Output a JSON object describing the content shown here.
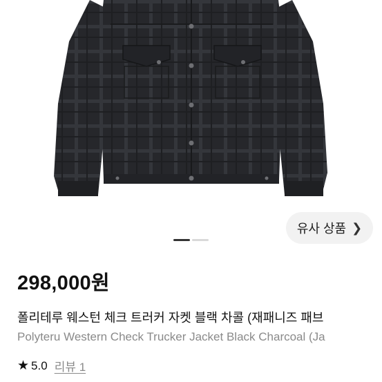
{
  "product": {
    "similar_button_label": "유사 상품",
    "price": "298,000원",
    "title_ko": "폴리테루 웨스턴 체크 트러커 자켓 블랙 차콜 (재패니즈 패브",
    "title_en": "Polyteru Western Check Trucker Jacket Black Charcoal (Ja",
    "rating_score": "5.0",
    "review_link": "리뷰 1"
  },
  "gallery": {
    "pages": 2,
    "active_page": 1
  },
  "icons": {
    "similar_chevron": "chevron-right-icon",
    "rating_star": "star-icon"
  }
}
